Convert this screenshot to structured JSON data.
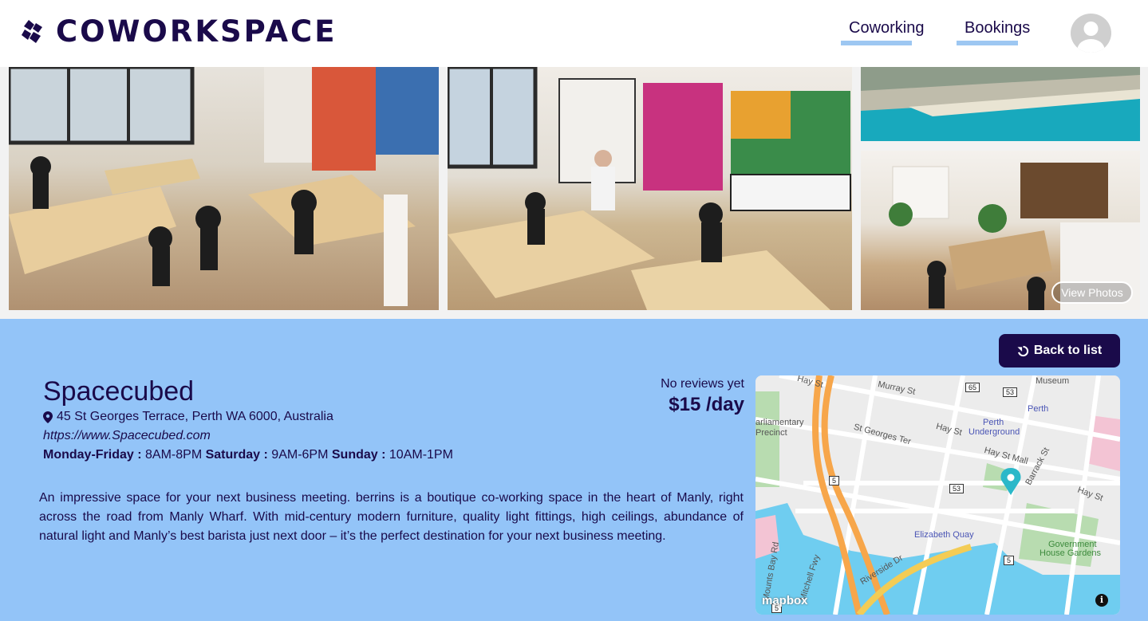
{
  "brand": {
    "name": "COWORKSPACE"
  },
  "nav": {
    "coworking": "Coworking",
    "bookings": "Bookings"
  },
  "gallery": {
    "view_photos": "View Photos"
  },
  "actions": {
    "back_to_list": "Back to list"
  },
  "space": {
    "name": "Spacecubed",
    "address": "45 St Georges Terrace, Perth WA 6000, Australia",
    "website": "https://www.Spacecubed.com",
    "hours": [
      {
        "days": "Monday-Friday :",
        "time": "8AM-8PM"
      },
      {
        "days": "Saturday :",
        "time": "9AM-6PM"
      },
      {
        "days": "Sunday :",
        "time": "10AM-1PM"
      }
    ],
    "reviews": "No reviews yet",
    "price": "$15 /day",
    "description": "An impressive space for your next business meeting. berrins is a boutique co-working space in the heart of Manly, right across the road from Manly Wharf. With mid-century modern furniture, quality light fittings, high ceilings, abundance of natural light and Manly’s best barista just next door – it’s the perfect destination for your next business meeting."
  },
  "map": {
    "labels": {
      "hay_st_1": "Hay St",
      "murray_st": "Murray St",
      "museum": "Museum",
      "perth": "Perth",
      "parliamentary": "arliamentary",
      "precinct": "Precinct",
      "st_georges_ter": "St Georges Ter",
      "hay_st_2": "Hay St",
      "perth_underground_1": "Perth",
      "perth_underground_2": "Underground",
      "hay_st_mall": "Hay St Mall",
      "barrack_st": "Barrack St",
      "hay_st_3": "Hay St",
      "elizabeth_quay": "Elizabeth Quay",
      "government_1": "Government",
      "government_2": "House Gardens",
      "mounts_bay_rd": "Mounts Bay Rd",
      "mitchell_fwy": "Mitchell Fwy",
      "riverside_dr": "Riverside Dr",
      "shield_65": "65",
      "shield_53a": "53",
      "shield_53b": "53",
      "shield_5a": "5",
      "shield_5b": "5",
      "shield_5c": "5"
    },
    "attribution": "mapbox",
    "info": "i",
    "colors": {
      "water": "#6fcdf0",
      "park": "#b8dcb0",
      "freeway": "#f7a64a",
      "road": "#ffffff"
    }
  },
  "colors": {
    "brand_dark": "#1a0a4a",
    "accent_light": "#93c4f8",
    "nav_underline": "#9dc7f2"
  }
}
